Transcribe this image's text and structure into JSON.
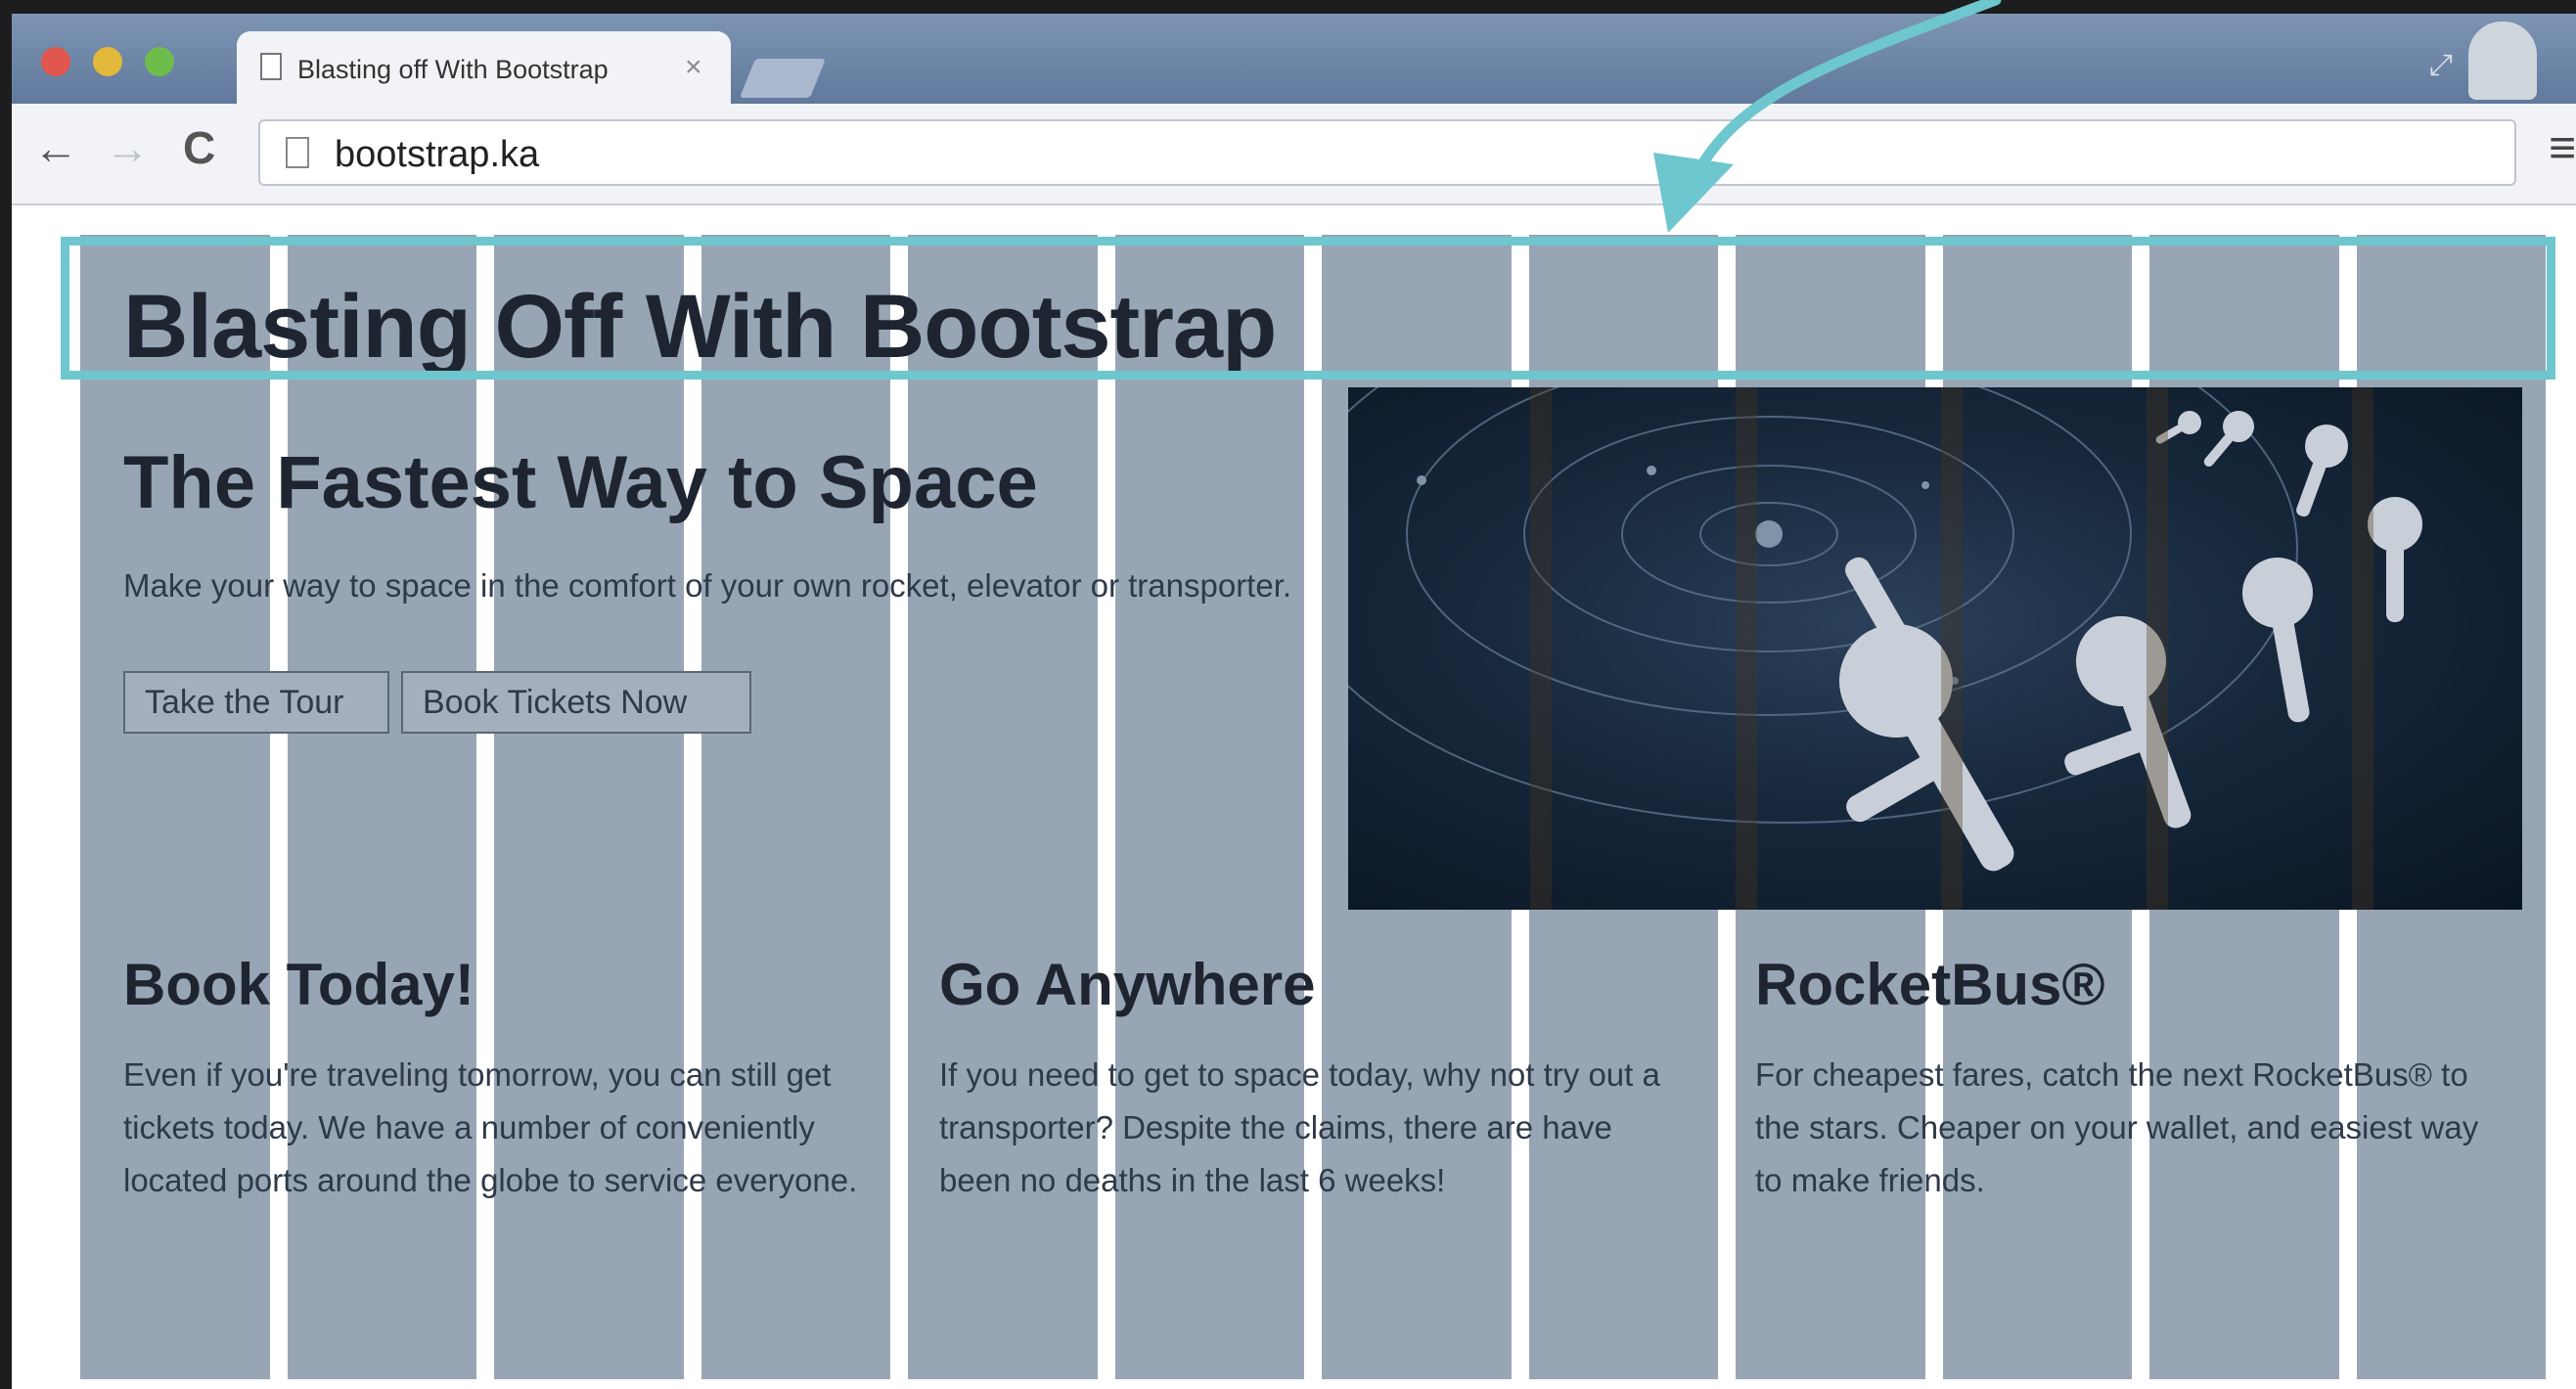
{
  "browser": {
    "tab_title": "Blasting off With Bootstrap",
    "tab_close": "×",
    "url": "bootstrap.ka",
    "nav": {
      "back": "←",
      "forward": "→",
      "reload": "C"
    },
    "menu": "≡",
    "fullscreen": "⤢"
  },
  "page": {
    "title": "Blasting Off With Bootstrap",
    "lead": {
      "heading": "The Fastest Way to Space",
      "text": "Make your way to space in the comfort of your own rocket, elevator or transporter.",
      "buttons": [
        "Take the Tour",
        "Book Tickets Now"
      ]
    },
    "features": [
      {
        "heading": "Book Today!",
        "text": "Even if you're traveling tomorrow, you can still get tickets today. We have a number of conveniently located ports around the globe to service everyone."
      },
      {
        "heading": "Go Anywhere",
        "text": "If you need to get to space today, why not try out a transporter? Despite the claims, there are have been no deaths in the last 6 weeks!"
      },
      {
        "heading": "RocketBus®",
        "text": "For cheapest fares, catch the next RocketBus® to the stars. Cheaper on your wallet, and easiest way to make friends."
      }
    ]
  },
  "overlay": {
    "grid_columns": 12
  },
  "colors": {
    "highlight": "#6ec6cf",
    "column_overlay": "#98a5b4",
    "tab_strip": "#6c84a6"
  }
}
